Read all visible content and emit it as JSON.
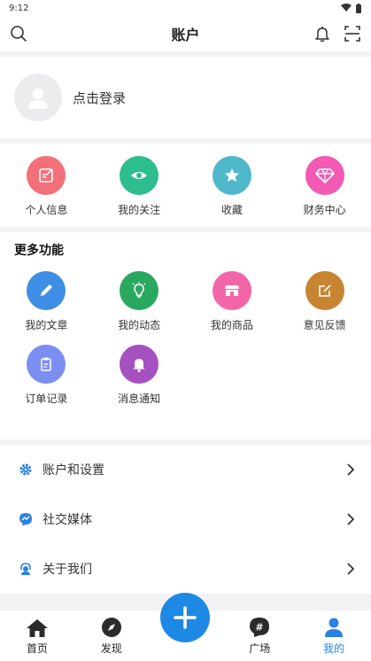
{
  "status_bar": {
    "time": "9:12"
  },
  "header": {
    "title": "账户",
    "search_icon": "search-icon",
    "bell_icon": "bell-icon",
    "scan_icon": "scan-icon"
  },
  "profile": {
    "login_text": "点击登录"
  },
  "quick_actions": [
    {
      "label": "个人信息",
      "icon": "edit-icon",
      "color": "#f2707a"
    },
    {
      "label": "我的关注",
      "icon": "eye-icon",
      "color": "#2ebd8e"
    },
    {
      "label": "收藏",
      "icon": "star-icon",
      "color": "#4fb8c9"
    },
    {
      "label": "财务中心",
      "icon": "diamond-icon",
      "color": "#f25ab4"
    }
  ],
  "more_features": {
    "title": "更多功能",
    "items": [
      {
        "label": "我的文章",
        "icon": "pencil-icon",
        "color": "#3f8ee6"
      },
      {
        "label": "我的动态",
        "icon": "lightbulb-icon",
        "color": "#2aa860"
      },
      {
        "label": "我的商品",
        "icon": "store-icon",
        "color": "#f266a8"
      },
      {
        "label": "意见反馈",
        "icon": "feedback-icon",
        "color": "#c78431"
      },
      {
        "label": "订单记录",
        "icon": "clipboard-icon",
        "color": "#7b8ff2"
      },
      {
        "label": "消息通知",
        "icon": "bell-icon",
        "color": "#a552c0"
      }
    ]
  },
  "settings": [
    {
      "label": "账户和设置",
      "icon": "gear-icon",
      "color": "#2a82e4"
    },
    {
      "label": "社交媒体",
      "icon": "messenger-icon",
      "color": "#2a82e4"
    },
    {
      "label": "关于我们",
      "icon": "support-icon",
      "color": "#2a82e4"
    }
  ],
  "tabbar": {
    "items": [
      {
        "label": "首页",
        "icon": "home-icon"
      },
      {
        "label": "发现",
        "icon": "compass-icon"
      },
      {
        "label": "",
        "icon": "plus-icon"
      },
      {
        "label": "广场",
        "icon": "hashtag-icon"
      },
      {
        "label": "我的",
        "icon": "user-icon",
        "active": true
      }
    ],
    "active_color": "#2a82e4",
    "fab_color": "#1e88e5"
  }
}
